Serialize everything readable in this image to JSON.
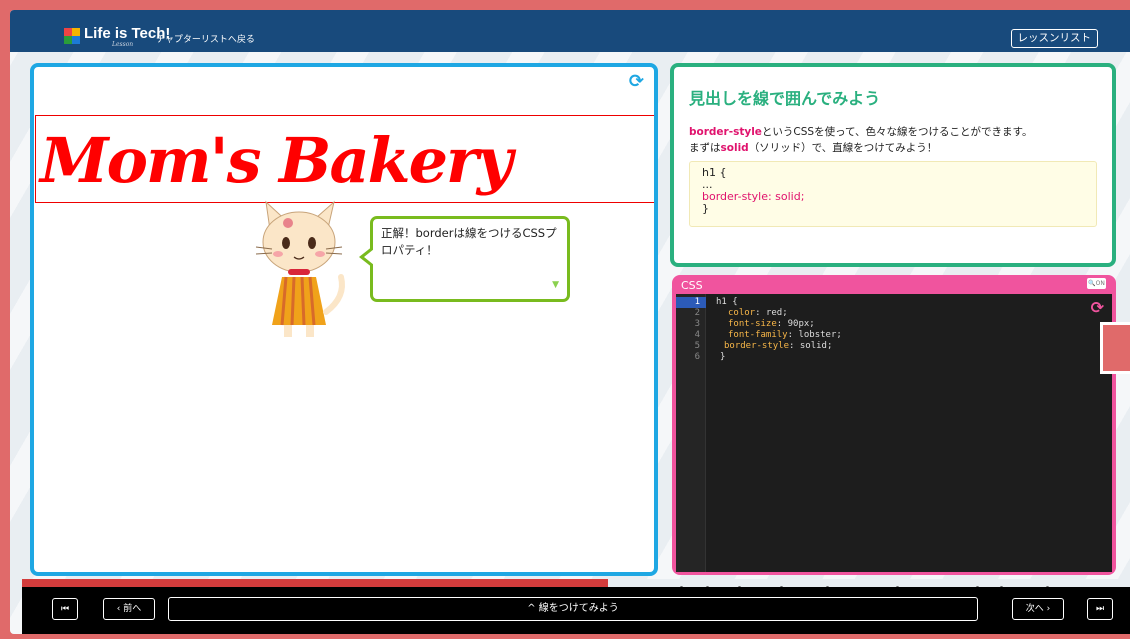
{
  "header": {
    "logo_text": "Life is Tech!",
    "logo_sub": "Lesson",
    "back_link": "チャプターリストへ戻る",
    "lesson_list_button": "レッスンリスト"
  },
  "preview": {
    "heading": "Mom's Bakery",
    "refresh_icon": "refresh-icon",
    "bubble_text": "正解！borderは線をつけるCSSプロパティ！",
    "bubble_arrow": "▼"
  },
  "instructions": {
    "title": "見出しを線で囲んでみよう",
    "line1_pink": "border-style",
    "line1_rest": "というCSSを使って、色々な線をつけることができます。",
    "line2_pre": "まずは",
    "line2_pink": "solid",
    "line2_rest": "（ソリッド）で、直線をつけてみよう！",
    "sample_line1": "h1 {",
    "sample_line2": "...",
    "sample_line3": "border-style: solid;",
    "sample_line4": "}"
  },
  "css_editor": {
    "label": "CSS",
    "zoom_label": "ON",
    "line_numbers": [
      "1",
      "2",
      "3",
      "4",
      "5",
      "6"
    ],
    "lines": [
      {
        "prop": "",
        "val": "h1 {"
      },
      {
        "prop": "color",
        "val": "red;"
      },
      {
        "prop": "font-size",
        "val": "90px;"
      },
      {
        "prop": "font-family",
        "val": "lobster;"
      },
      {
        "prop": "border-style",
        "val": "solid;"
      },
      {
        "prop": "",
        "val": "}"
      }
    ]
  },
  "footer": {
    "first_label": "⏮",
    "prev_label": "‹ 前へ",
    "title": "^ 線をつけてみよう",
    "next_label": "次へ ›",
    "last_label": "⏭"
  },
  "colors": {
    "outer": "#e06a6a",
    "topbar": "#184a7c",
    "preview_border": "#1ea7e3",
    "instruction_border": "#2ab07f",
    "css_panel": "#f0549e",
    "heading_red": "#ff0000",
    "bubble_border": "#79bb1e"
  }
}
